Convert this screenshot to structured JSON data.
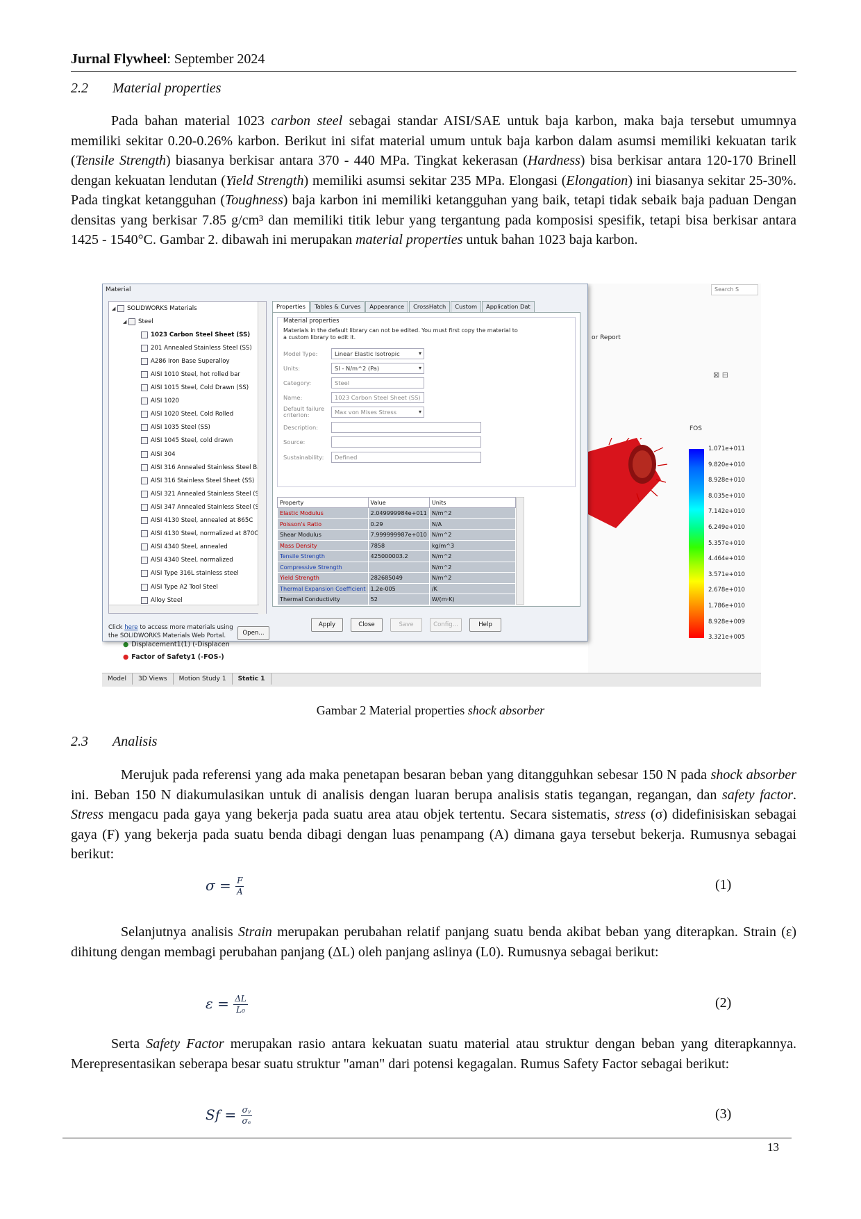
{
  "header": {
    "journal": "Jurnal Flywheel",
    "date": ": September 2024"
  },
  "section_22": {
    "num": "2.2",
    "title": "Material properties"
  },
  "para1": [
    "Pada bahan material 1023 ",
    "carbon steel",
    " sebagai standar AISI/SAE untuk baja karbon, maka baja tersebut umumnya memiliki sekitar 0.20-0.26% karbon. Berikut ini sifat material umum untuk baja karbon dalam asumsi memiliki kekuatan tarik (",
    "Tensile Strength",
    ") biasanya berkisar antara 370 - 440 MPa. Tingkat kekerasan (",
    "Hardness",
    ") bisa berkisar antara 120-170 Brinell dengan kekuatan lendutan (",
    "Yield Strength",
    ") memiliki asumsi sekitar 235 MPa. Elongasi (",
    "Elongation",
    ") ini biasanya sekitar 25-30%. Pada tingkat ketangguhan (",
    "Toughness",
    ") baja karbon ini memiliki ketangguhan yang baik, tetapi tidak sebaik baja paduan Dengan densitas yang berkisar 7.85 g/cm³ dan memiliki titik lebur yang tergantung pada komposisi spesifik, tetapi bisa berkisar antara 1425 - 1540°C. Gambar 2. dibawah ini merupakan ",
    "material properties",
    " untuk bahan 1023 baja karbon."
  ],
  "figure": {
    "dialog_title": "Material",
    "search_placeholder": "Search S",
    "report_label": "or Report",
    "tree_root": "SOLIDWORKS Materials",
    "tree_group": "Steel",
    "tree_items": [
      "1023 Carbon Steel Sheet (SS)",
      "201 Annealed Stainless Steel (SS)",
      "A286 Iron Base Superalloy",
      "AISI 1010 Steel, hot rolled bar",
      "AISI 1015 Steel, Cold Drawn (SS)",
      "AISI 1020",
      "AISI 1020 Steel, Cold Rolled",
      "AISI 1035 Steel (SS)",
      "AISI 1045 Steel, cold drawn",
      "AISI 304",
      "AISI 316 Annealed Stainless Steel Ba",
      "AISI 316 Stainless Steel Sheet (SS)",
      "AISI 321 Annealed Stainless Steel (S",
      "AISI 347 Annealed Stainless Steel (S",
      "AISI 4130 Steel, annealed at 865C",
      "AISI 4130 Steel, normalized at 870C",
      "AISI 4340 Steel, annealed",
      "AISI 4340 Steel, normalized",
      "AISI Type 316L stainless steel",
      "AISI Type A2 Tool Steel",
      "Alloy Steel"
    ],
    "help_link": "here",
    "help_pre": "Click ",
    "help_post": " to access more materials using",
    "help_line2": "the SOLIDWORKS Materials Web Portal.",
    "open_button": "Open...",
    "tabs": [
      "Properties",
      "Tables & Curves",
      "Appearance",
      "CrossHatch",
      "Custom",
      "Application Dat"
    ],
    "mp_legend": "Material properties",
    "mp_note": "Materials in the default library can not be edited. You must first copy the material to a custom library to edit it.",
    "fields": {
      "model_type_label": "Model Type:",
      "model_type": "Linear Elastic Isotropic",
      "units_label": "Units:",
      "units": "SI - N/m^2 (Pa)",
      "category_label": "Category:",
      "category": "Steel",
      "name_label": "Name:",
      "name": "1023 Carbon Steel Sheet (SS)",
      "failure_label1": "Default failure",
      "failure_label2": "criterion:",
      "failure": "Max von Mises Stress",
      "description_label": "Description:",
      "description": "",
      "source_label": "Source:",
      "source": "",
      "sustainability_label": "Sustainability:",
      "sustainability": "Defined"
    },
    "table_headers": [
      "Property",
      "Value",
      "Units"
    ],
    "table_rows": [
      {
        "property": "Elastic Modulus",
        "value": "2.049999984e+011",
        "units": "N/m^2",
        "color": "red"
      },
      {
        "property": "Poisson's Ratio",
        "value": "0.29",
        "units": "N/A",
        "color": "red"
      },
      {
        "property": "Shear Modulus",
        "value": "7.999999987e+010",
        "units": "N/m^2",
        "color": ""
      },
      {
        "property": "Mass Density",
        "value": "7858",
        "units": "kg/m^3",
        "color": "red"
      },
      {
        "property": "Tensile Strength",
        "value": "425000003.2",
        "units": "N/m^2",
        "color": "blue"
      },
      {
        "property": "Compressive Strength",
        "value": "",
        "units": "N/m^2",
        "color": "blue"
      },
      {
        "property": "Yield Strength",
        "value": "282685049",
        "units": "N/m^2",
        "color": "red"
      },
      {
        "property": "Thermal Expansion Coefficient",
        "value": "1.2e-005",
        "units": "/K",
        "color": "blue"
      },
      {
        "property": "Thermal Conductivity",
        "value": "52",
        "units": "W/(m·K)",
        "color": ""
      }
    ],
    "buttons": [
      "Apply",
      "Close",
      "Save",
      "Config...",
      "Help"
    ],
    "fos_title": "FOS",
    "fos_ticks": [
      "1.071e+011",
      "9.820e+010",
      "8.928e+010",
      "8.035e+010",
      "7.142e+010",
      "6.249e+010",
      "5.357e+010",
      "4.464e+010",
      "3.571e+010",
      "2.678e+010",
      "1.786e+010",
      "8.928e+009",
      "3.321e+005"
    ],
    "tree_extra": [
      "Displacement1(1) (-Displacen",
      "Factor of Safety1 (-FOS-)"
    ],
    "bottom_tabs": [
      "Model",
      "3D Views",
      "Motion Study 1",
      "Static 1"
    ],
    "colors": {
      "fos_top": "#0000ff",
      "fos_bottom": "#ff0000",
      "part": "#d8141c"
    }
  },
  "caption": {
    "pre": "Gambar 2 Material properties ",
    "italic": "shock absorber"
  },
  "section_23": {
    "num": "2.3",
    "title": "Analisis"
  },
  "para2": [
    "Merujuk pada referensi yang ada maka penetapan besaran beban yang ditangguhkan sebesar 150 N pada ",
    "shock absorber",
    " ini. Beban 150 N diakumulasikan untuk di analisis dengan luaran berupa analisis statis tegangan, regangan, dan ",
    "safety factor",
    ". ",
    "Stress",
    " mengacu pada gaya yang bekerja pada suatu area atau objek tertentu. Secara sistematis, ",
    "stress",
    " (σ) didefinisiskan sebagai gaya (F) yang bekerja pada suatu benda dibagi dengan luas penampang (A) dimana gaya tersebut bekerja. Rumusnya sebagai berikut:"
  ],
  "eq1": {
    "lhs": "σ =",
    "num": "F",
    "den": "A",
    "no": "(1)"
  },
  "para3": [
    "Selanjutnya analisis ",
    "Strain",
    " merupakan perubahan relatif panjang suatu benda akibat beban yang diterapkan. Strain (ε) dihitung dengan membagi perubahan panjang (ΔL) oleh panjang aslinya (L0). Rumusnya sebagai berikut:"
  ],
  "eq2": {
    "lhs": "ε =",
    "num": "ΔL",
    "den": "L₀",
    "no": "(2)"
  },
  "para4": [
    "Serta ",
    "Safety Factor",
    " merupakan rasio antara kekuatan suatu material atau struktur dengan beban yang diterapkannya. Merepresentasikan seberapa besar suatu struktur \"aman\" dari potensi kegagalan. Rumus Safety Factor sebagai berikut:"
  ],
  "eq3": {
    "lhs": "Sf =",
    "num": "σᵧ",
    "den": "σₑ",
    "no": "(3)"
  },
  "page_number": "13"
}
